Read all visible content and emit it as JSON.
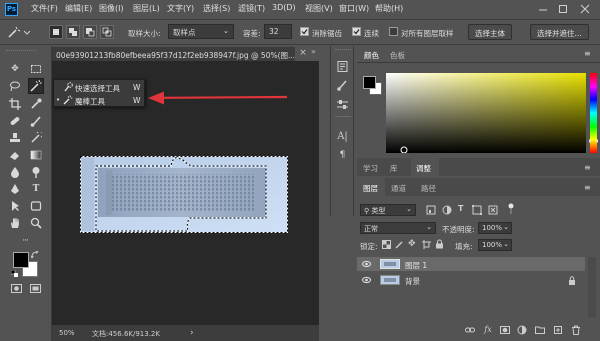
{
  "app": {
    "logo": "Ps"
  },
  "menu": [
    "文件(F)",
    "编辑(E)",
    "图像(I)",
    "图层(L)",
    "文字(Y)",
    "选择(S)",
    "滤镜(T)",
    "3D(D)",
    "视图(V)",
    "窗口(W)",
    "帮助(H)"
  ],
  "options": {
    "sample_size_label": "取样大小:",
    "sample_size_value": "取样点",
    "tolerance_label": "容差:",
    "tolerance_value": "32",
    "antialias_label": "消除锯齿",
    "contiguous_label": "连续",
    "all_layers_label": "对所有图层取样",
    "select_subject_button": "选择主体",
    "select_and_mask_button": "选择并遮住..."
  },
  "document": {
    "tab_title": "00e93901213fb80efbeea95f37d12f2eb938947f.jpg @ 50%(图...",
    "zoom": "50%",
    "doc_size": "文档:456.6K/913.2K"
  },
  "flyout": {
    "items": [
      {
        "label": "快速选择工具",
        "shortcut": "W"
      },
      {
        "label": "魔棒工具",
        "shortcut": "W"
      }
    ]
  },
  "color_panel": {
    "tabs": [
      "颜色",
      "色板"
    ]
  },
  "mid_panel": {
    "tabs": [
      "学习",
      "库",
      "调整"
    ]
  },
  "layers_panel": {
    "tabs": [
      "图层",
      "通道",
      "路径"
    ],
    "filter_kind": "类型",
    "blend_mode": "正常",
    "opacity_label": "不透明度:",
    "opacity_value": "100%",
    "lock_label": "锁定:",
    "fill_label": "填充:",
    "fill_value": "100%",
    "layers": [
      {
        "name": "图层 1"
      },
      {
        "name": "背景"
      }
    ]
  },
  "colors": {
    "accent_arrow": "#e0353a",
    "selected_layer": "#6a6a6a",
    "canvas_bg": "#282828"
  }
}
